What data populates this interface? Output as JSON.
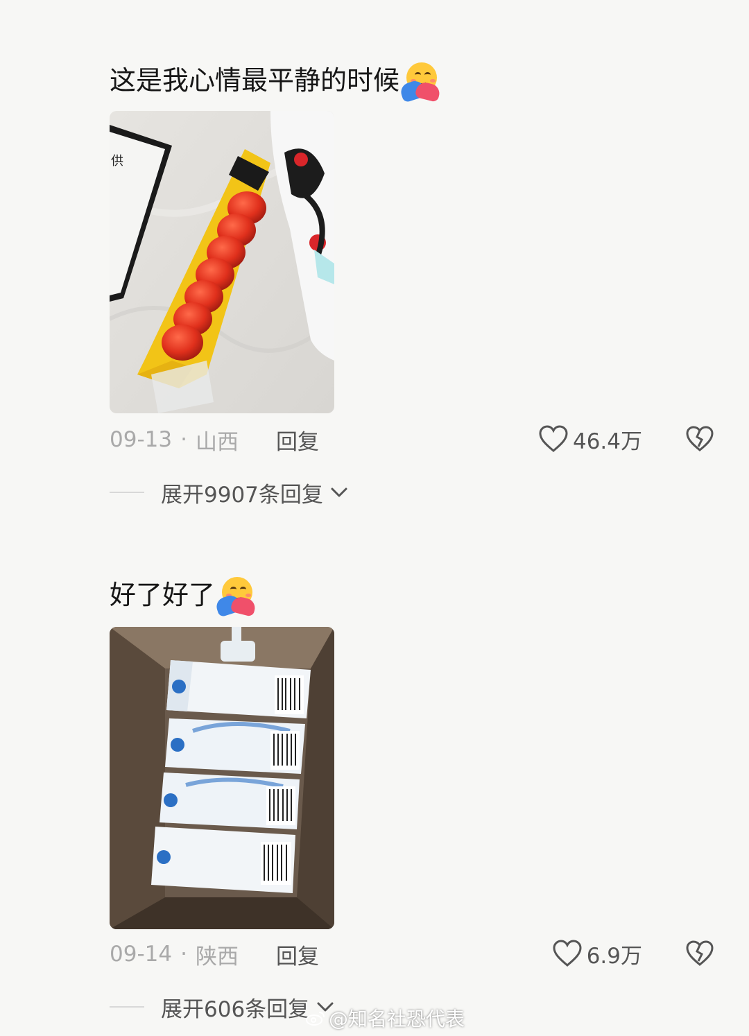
{
  "comments": [
    {
      "text": "这是我心情最平静的时候",
      "emoji": "hugging-face-emoji",
      "photo": "candied-hawthorn-skewer-photo",
      "date": "09-13",
      "separator": "·",
      "location": "山西",
      "reply_label": "回复",
      "likes": "46.4万",
      "expand_label": "展开9907条回复"
    },
    {
      "text": "好了好了",
      "emoji": "hugging-face-emoji",
      "photo": "milk-cartons-in-box-photo",
      "date": "09-14",
      "separator": "·",
      "location": "陕西",
      "reply_label": "回复",
      "likes": "6.9万",
      "expand_label": "展开606条回复"
    }
  ],
  "icons": {
    "like": "heart-outline-icon",
    "dislike": "broken-heart-icon",
    "expand": "chevron-down-icon"
  },
  "watermark": "@知名社恐代表"
}
